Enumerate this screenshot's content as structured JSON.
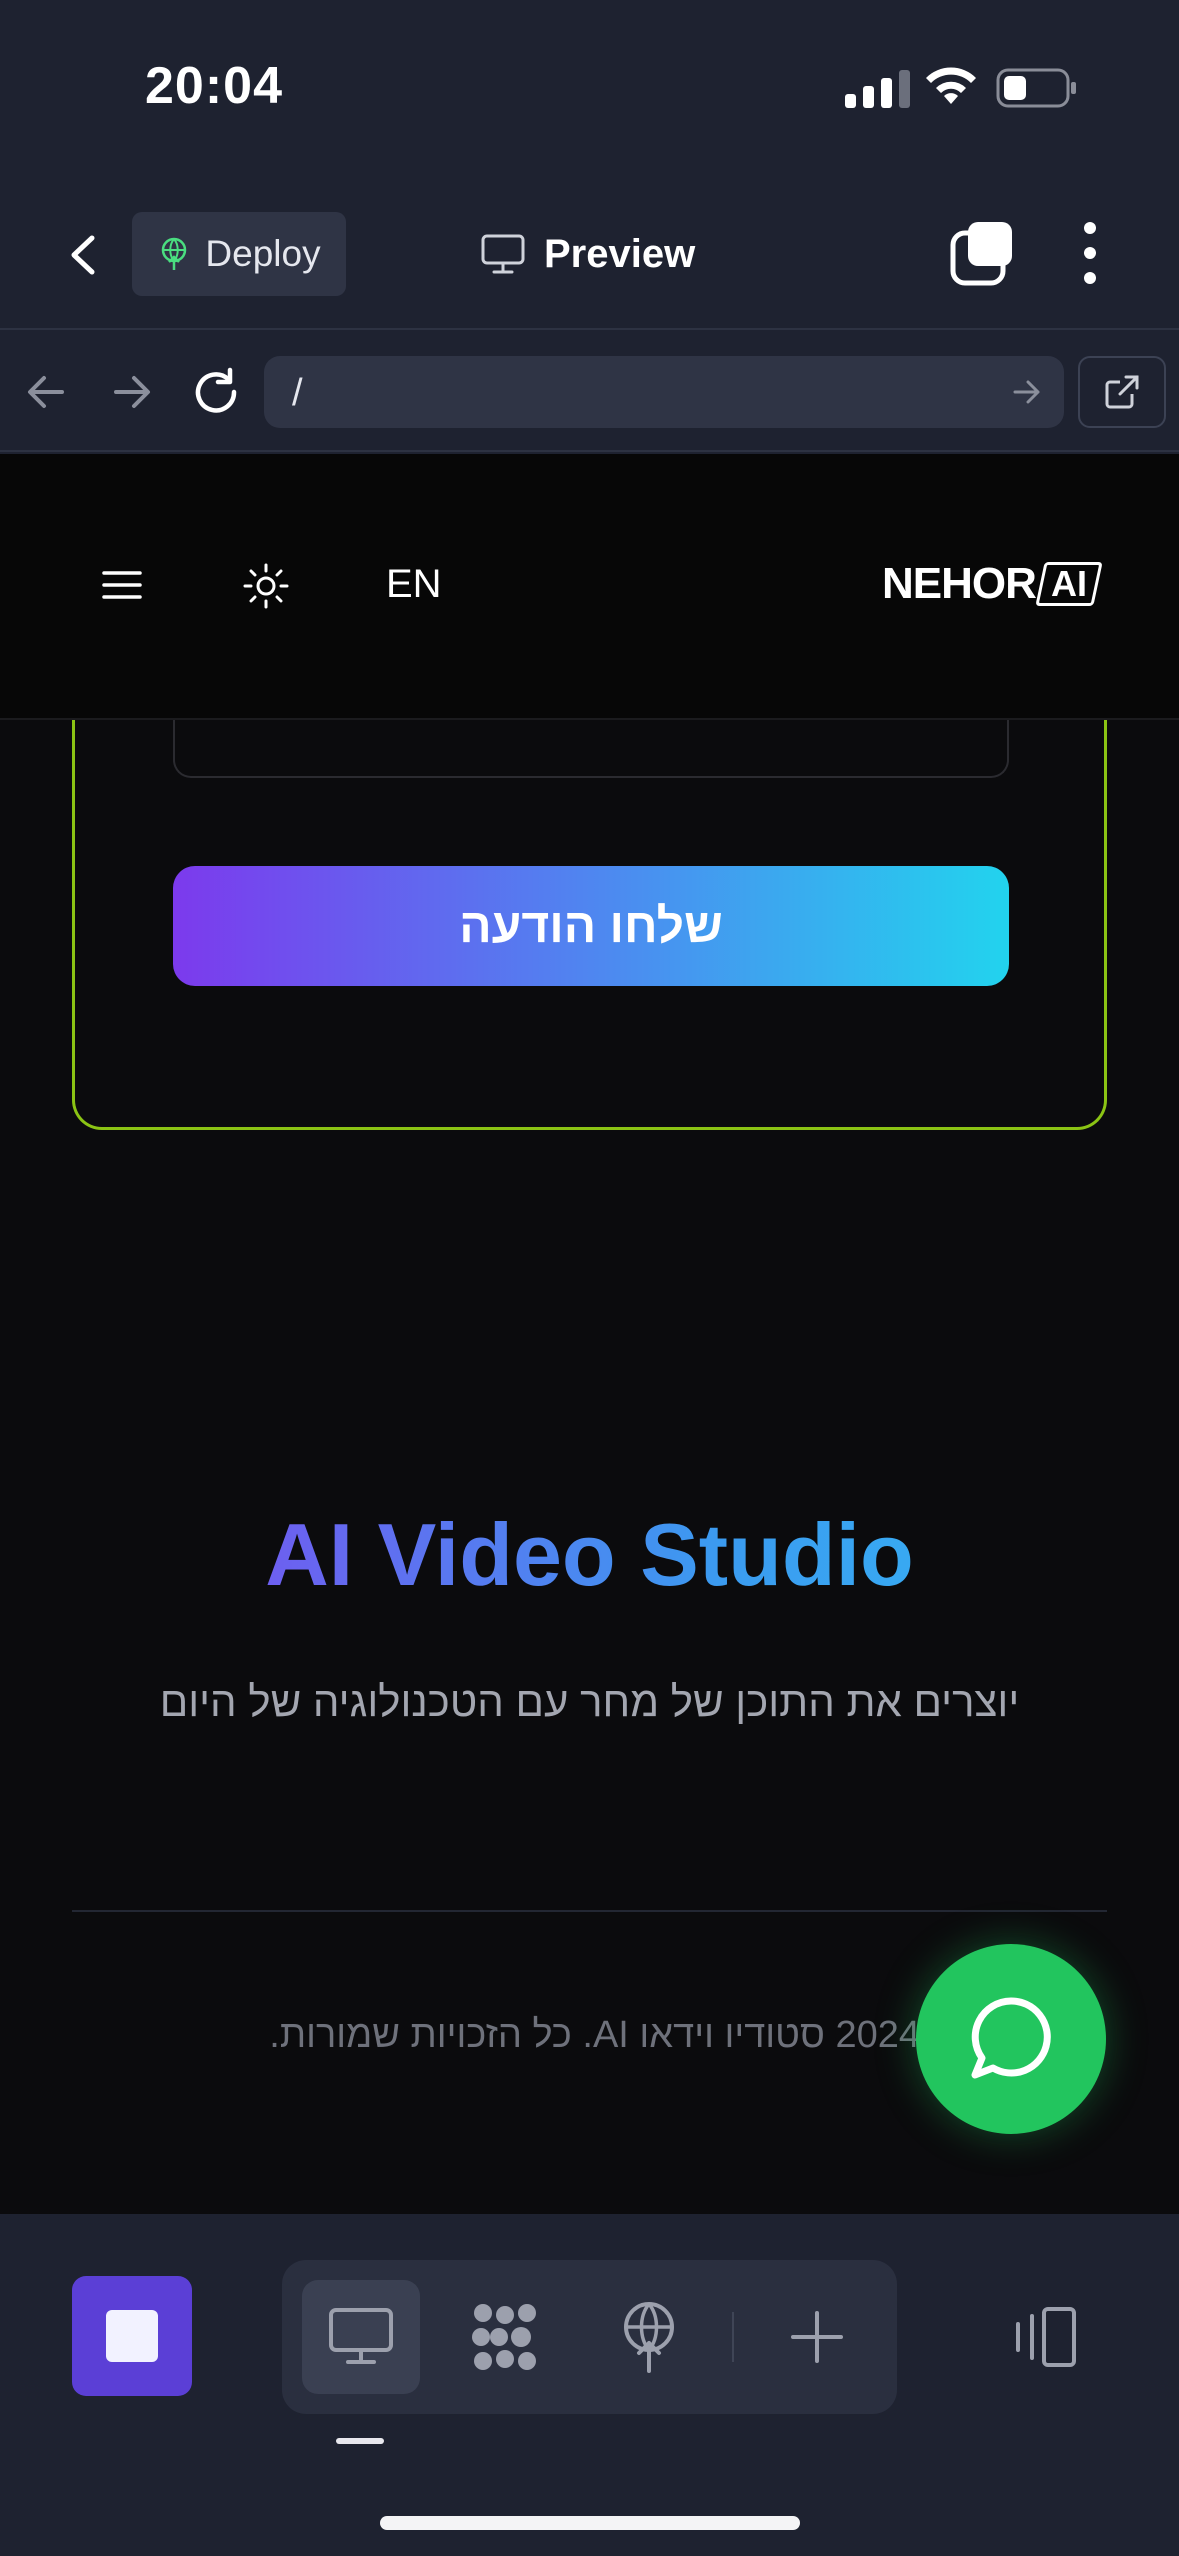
{
  "status_bar": {
    "time": "20:04"
  },
  "app_bar": {
    "deploy_label": "Deploy",
    "preview_label": "Preview"
  },
  "url_bar": {
    "path": "/"
  },
  "site": {
    "language_toggle": "EN",
    "logo_word": "NEHOR",
    "logo_ai": "AI",
    "send_button": "שלחו הודעה",
    "studio_title": "AI Video Studio",
    "tagline": "יוצרים את התוכן של מחר עם הטכנולוגיה של היום",
    "copyright": "2024 סטודיו וידאו AI. כל הזכויות שמורות."
  },
  "colors": {
    "accent_green": "#8bc414",
    "gradient_start": "#7c3aed",
    "gradient_end": "#22d3ee",
    "chat_green": "#22c55e",
    "stop_purple": "#5b3fd6"
  },
  "icons": [
    "back-chevron-icon",
    "deploy-icon",
    "monitor-icon",
    "tabs-icon",
    "more-vertical-icon",
    "arrow-left-icon",
    "arrow-right-icon",
    "reload-icon",
    "open-external-icon",
    "hamburger-icon",
    "sun-icon",
    "chat-icon",
    "stop-icon",
    "desktop-icon",
    "pattern-icon",
    "globe-deploy-icon",
    "plus-icon",
    "device-toggle-icon"
  ]
}
